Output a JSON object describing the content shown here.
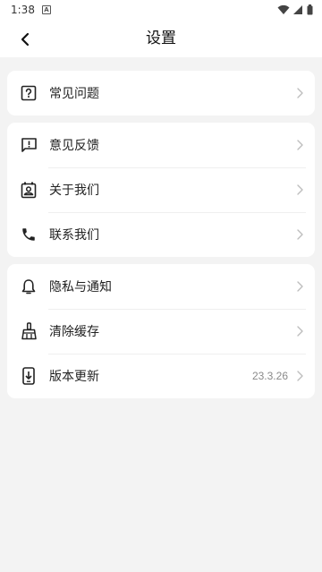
{
  "status_bar": {
    "time": "1:38"
  },
  "header": {
    "title": "设置"
  },
  "groups": [
    {
      "items": [
        {
          "icon": "help-square-icon",
          "label": "常见问题"
        }
      ]
    },
    {
      "items": [
        {
          "icon": "feedback-icon",
          "label": "意见反馈"
        },
        {
          "icon": "contact-card-icon",
          "label": "关于我们"
        },
        {
          "icon": "phone-icon",
          "label": "联系我们"
        }
      ]
    },
    {
      "items": [
        {
          "icon": "bell-icon",
          "label": "隐私与通知"
        },
        {
          "icon": "broom-icon",
          "label": "清除缓存"
        },
        {
          "icon": "phone-download-icon",
          "label": "版本更新",
          "value": "23.3.26"
        }
      ]
    }
  ]
}
